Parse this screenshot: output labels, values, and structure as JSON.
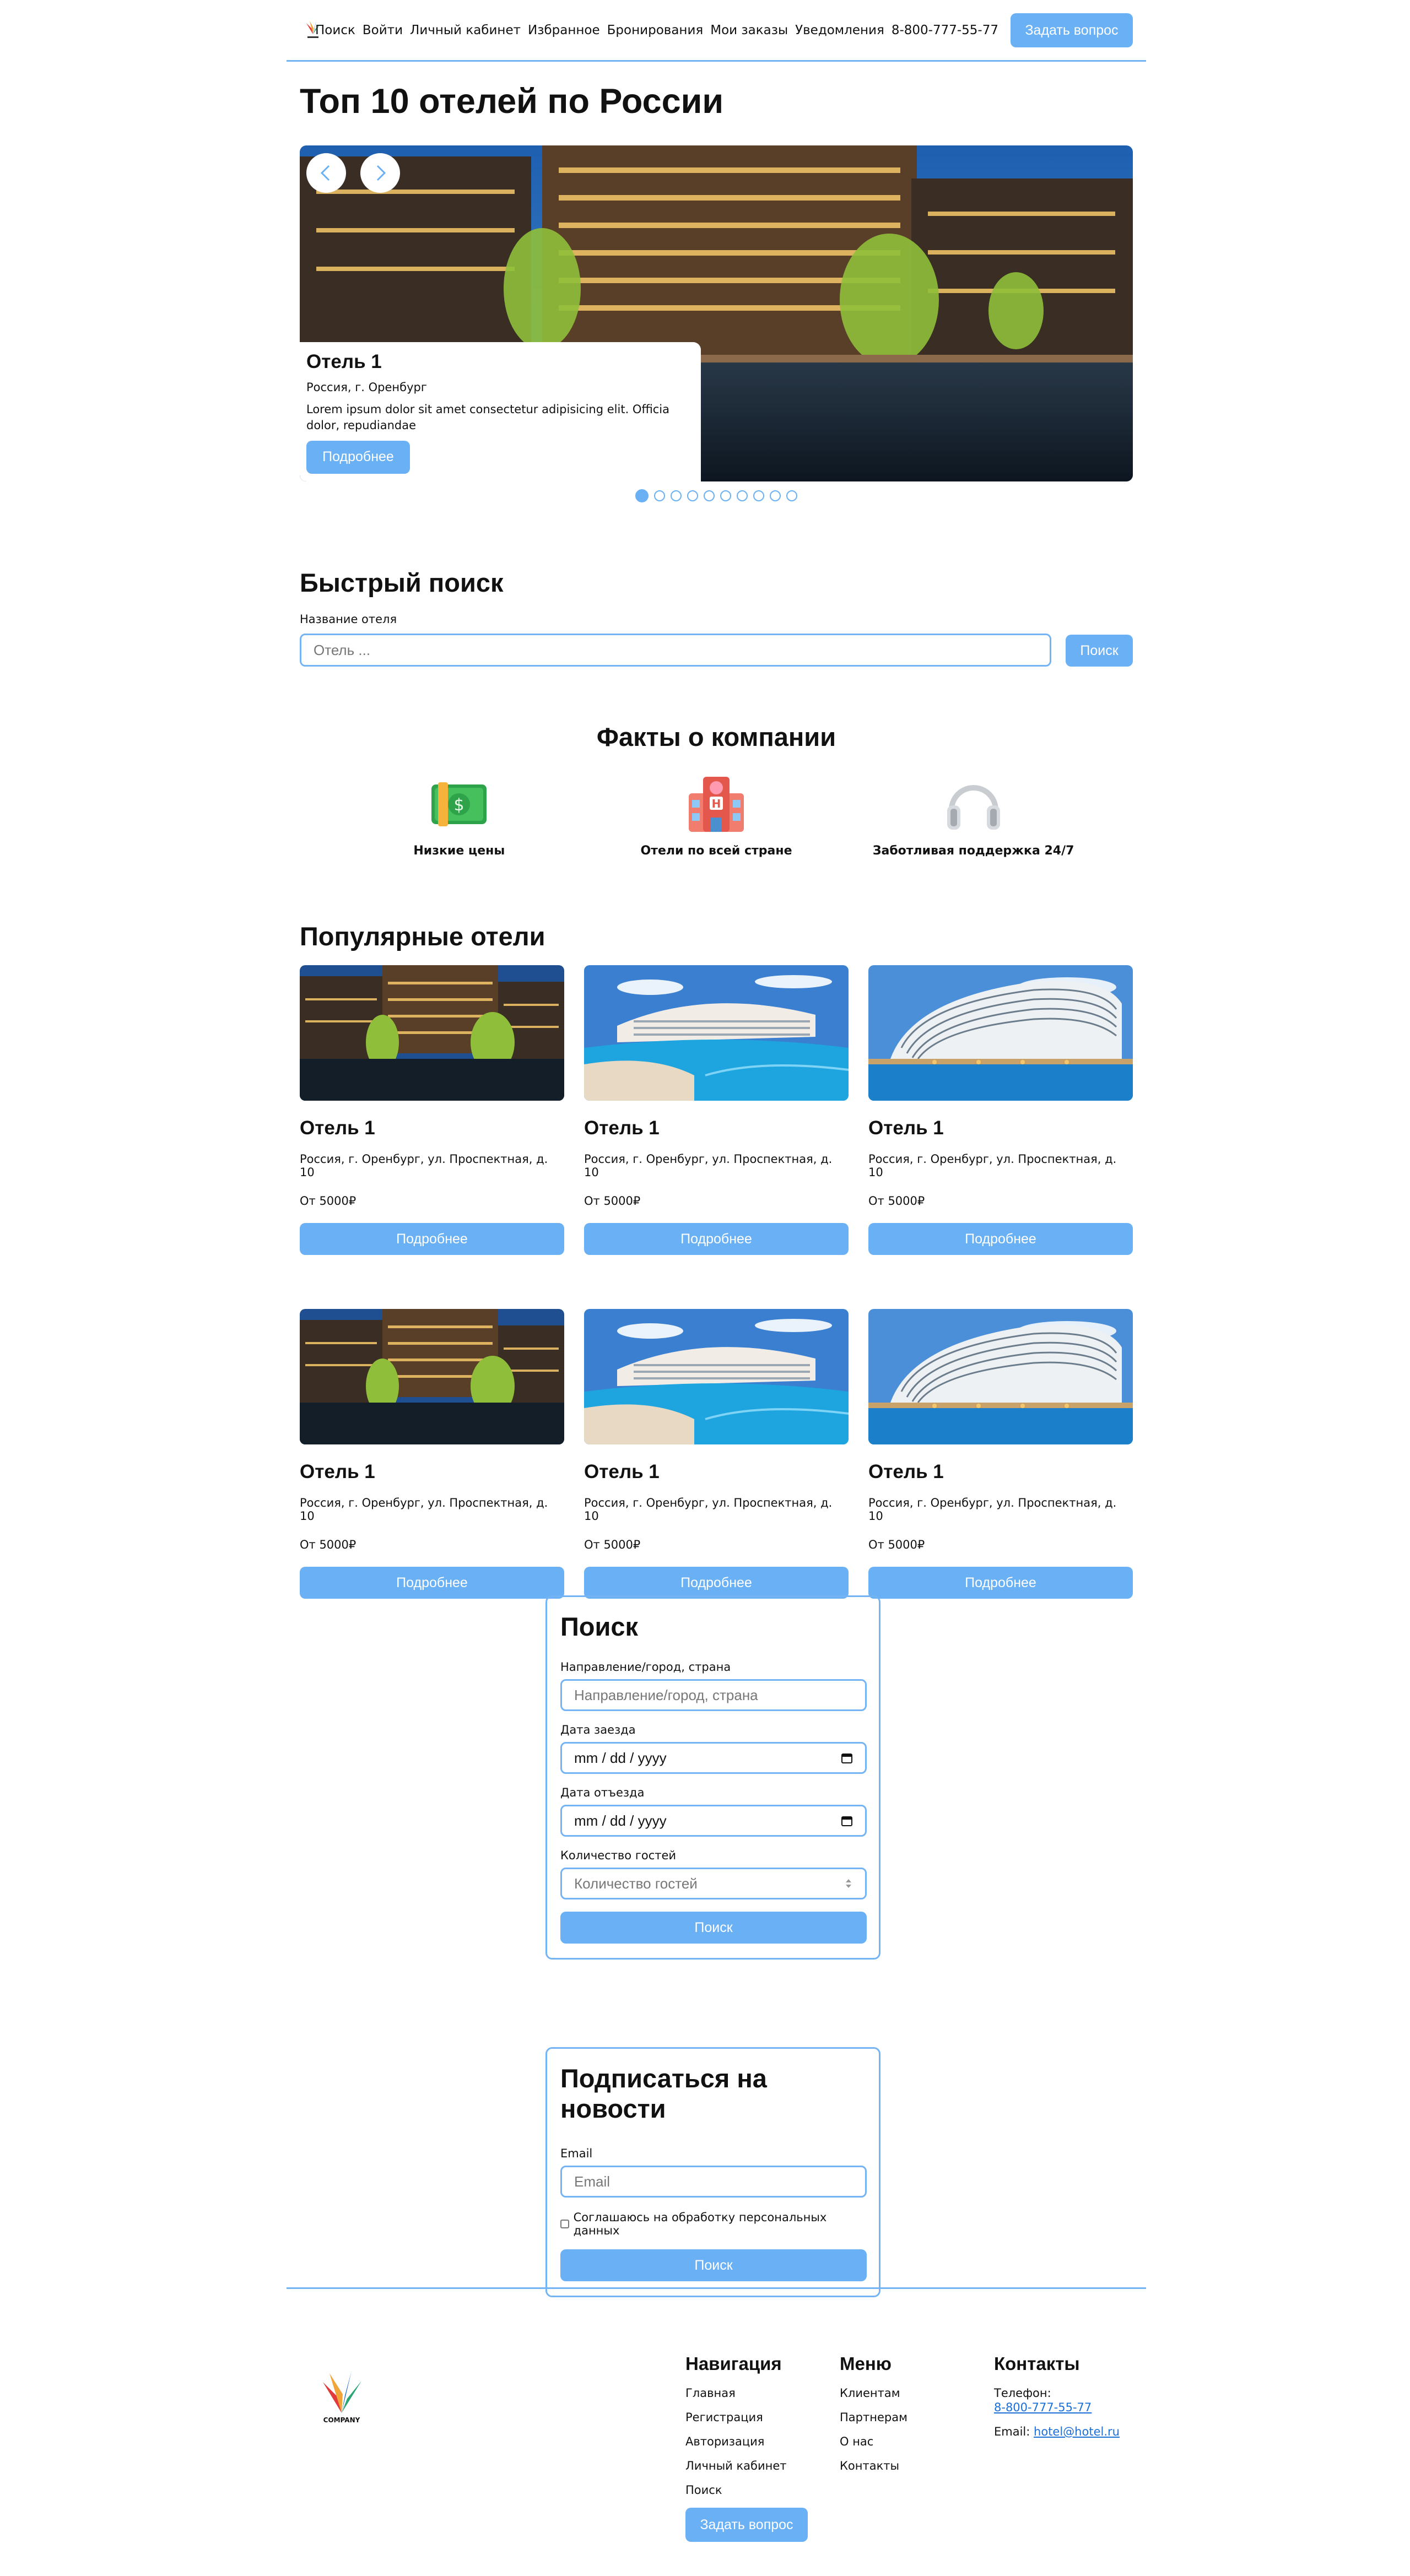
{
  "header": {
    "nav": [
      "Поиск",
      "Войти",
      "Личный кабинет",
      "Избранное",
      "Бронирования",
      "Мои заказы",
      "Уведомления"
    ],
    "phone": "8-800-777-55-77",
    "ask_button": "Задать вопрос"
  },
  "hero": {
    "title": "Топ 10 отелей по России",
    "slide": {
      "name": "Отель 1",
      "location": "Россия, г. Оренбург",
      "description": "Lorem ipsum dolor sit amet consectetur adipisicing elit. Officia dolor, repudiandae",
      "button": "Подробнее"
    },
    "slide_count": 10,
    "active_slide": 1
  },
  "quick_search": {
    "title": "Быстрый поиск",
    "label": "Название отеля",
    "placeholder": "Отель ...",
    "button": "Поиск"
  },
  "facts": {
    "title": "Факты о компании",
    "items": [
      {
        "label": "Низкие цены",
        "icon": "money-icon"
      },
      {
        "label": "Отели по всей стране",
        "icon": "hotel-icon"
      },
      {
        "label": "Заботливая поддержка 24/7",
        "icon": "headphones-icon"
      }
    ]
  },
  "popular": {
    "title": "Популярные отели",
    "hotels": [
      {
        "name": "Отель 1",
        "address": "Россия, г. Оренбург, ул. Проспектная, д. 10",
        "price": "От 5000₽",
        "button": "Подробнее",
        "image": "night-resort"
      },
      {
        "name": "Отель 1",
        "address": "Россия, г. Оренбург, ул. Проспектная, д. 10",
        "price": "От 5000₽",
        "button": "Подробнее",
        "image": "pool-resort"
      },
      {
        "name": "Отель 1",
        "address": "Россия, г. Оренбург, ул. Проспектная, д. 10",
        "price": "От 5000₽",
        "button": "Подробнее",
        "image": "wave-hotel"
      },
      {
        "name": "Отель 1",
        "address": "Россия, г. Оренбург, ул. Проспектная, д. 10",
        "price": "От 5000₽",
        "button": "Подробнее",
        "image": "night-resort"
      },
      {
        "name": "Отель 1",
        "address": "Россия, г. Оренбург, ул. Проспектная, д. 10",
        "price": "От 5000₽",
        "button": "Подробнее",
        "image": "pool-resort"
      },
      {
        "name": "Отель 1",
        "address": "Россия, г. Оренбург, ул. Проспектная, д. 10",
        "price": "От 5000₽",
        "button": "Подробнее",
        "image": "wave-hotel"
      }
    ]
  },
  "search_form": {
    "title": "Поиск",
    "direction_label": "Направление/город, страна",
    "direction_placeholder": "Направление/город, страна",
    "checkin_label": "Дата заезда",
    "checkin_value": "mm / dd / yyyy",
    "checkout_label": "Дата отъезда",
    "checkout_value": "mm / dd / yyyy",
    "guests_label": "Количество гостей",
    "guests_placeholder": "Количество гостей",
    "button": "Поиск"
  },
  "newsletter": {
    "title": "Подписаться на новости",
    "email_label": "Email",
    "email_placeholder": "Email",
    "consent": "Соглашаюсь на обработку персональных данных",
    "button": "Поиск"
  },
  "footer": {
    "logo_text": "COMPANY",
    "nav_title": "Навигация",
    "nav_items": [
      "Главная",
      "Регистрация",
      "Авторизация",
      "Личный кабинет",
      "Поиск"
    ],
    "ask_button": "Задать вопрос",
    "menu_title": "Меню",
    "menu_items": [
      "Клиентам",
      "Партнерам",
      "О нас",
      "Контакты"
    ],
    "contacts_title": "Контакты",
    "phone_label": "Телефон:",
    "phone": "8-800-777-55-77",
    "email_label": "Email:",
    "email": "hotel@hotel.ru"
  },
  "colors": {
    "accent": "#69b0f5",
    "border": "#74b4f5",
    "link": "#1a6fd8"
  }
}
